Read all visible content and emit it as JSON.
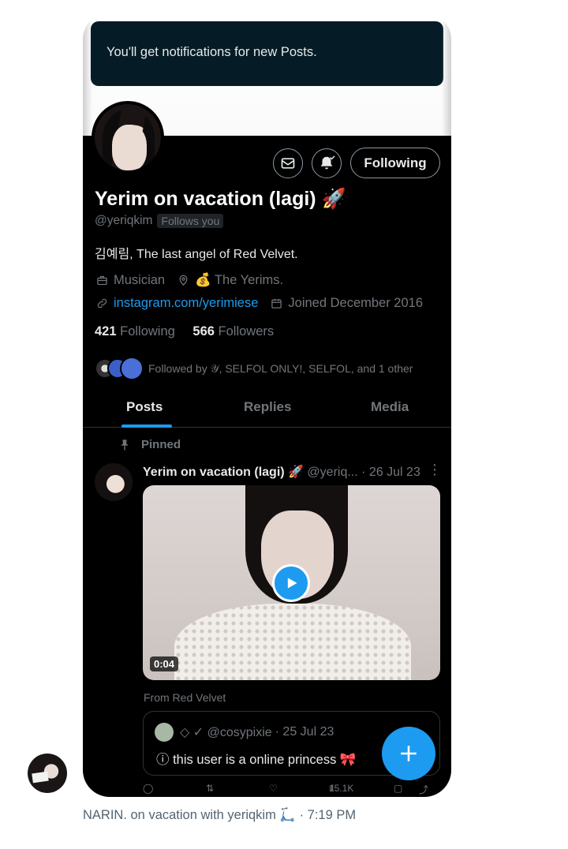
{
  "toast": {
    "text": "You'll get notifications for new Posts."
  },
  "profile": {
    "name": "Yerim on vacation (lagi) 🚀",
    "handle": "@yeriqkim",
    "follows_you": "Follows you",
    "bio": "김예림, The last angel of Red Velvet.",
    "category": "Musician",
    "location": "💰 The Yerims.",
    "website": "instagram.com/yerimiese",
    "joined": "Joined December 2016",
    "following_count": "421",
    "following_label": "Following",
    "followers_count": "566",
    "followers_label": "Followers",
    "followed_by": "Followed by 𝒴, SELFOL ONLY!, SELFOL, and 1 other",
    "buttons": {
      "message_icon": "mail-icon",
      "notify_icon": "bell-check-icon",
      "following": "Following"
    }
  },
  "tabs": [
    {
      "label": "Posts",
      "active": true
    },
    {
      "label": "Replies",
      "active": false
    },
    {
      "label": "Media",
      "active": false
    }
  ],
  "post": {
    "pinned_label": "Pinned",
    "author_name": "Yerim on vacation (lagi) 🚀",
    "author_handle": "@yeriq...",
    "date": "· 26 Jul 23",
    "video_duration": "0:04",
    "from": "From Red Velvet",
    "quote": {
      "handle": "◇ ✓ @cosypixie",
      "date": "· 25 Jul 23",
      "text": "ⓘ this user is a online princess 🎀"
    },
    "views": "15.1K"
  },
  "accent_color": "#1d9bf0",
  "chat": {
    "sender_line": "NARIN. on vacation with yeriqkim 🛴",
    "time": "· 7:19 PM"
  }
}
